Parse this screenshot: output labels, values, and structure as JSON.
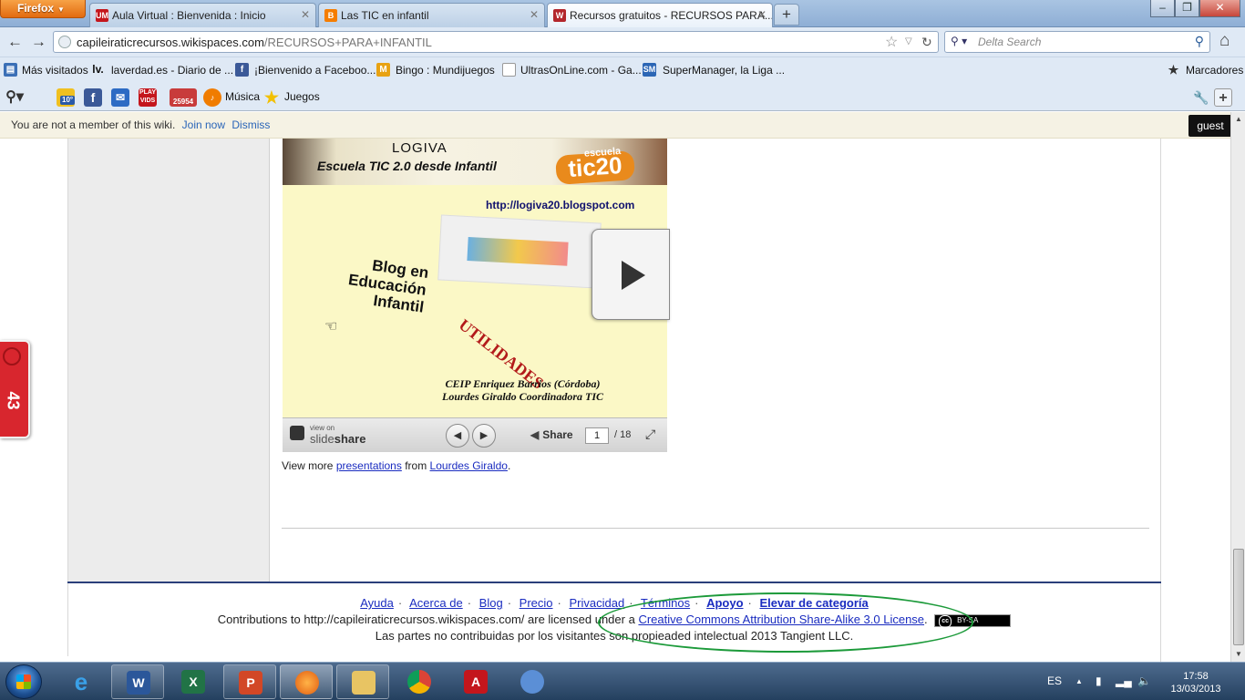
{
  "browser": {
    "menu_label": "Firefox",
    "tabs": [
      {
        "title": "Aula Virtual : Bienvenida : Inicio",
        "favicon": "UM"
      },
      {
        "title": "Las TIC en infantil",
        "favicon": "B"
      },
      {
        "title": "Recursos gratuitos - RECURSOS PARA...",
        "favicon": "W"
      }
    ],
    "new_tab": "+",
    "window_buttons": {
      "minimize": "–",
      "maximize": "❐",
      "close": "✕"
    }
  },
  "navbar": {
    "back": "←",
    "forward": "→",
    "url_host": "capileiraticrecursos.wikispaces.com",
    "url_path": "/RECURSOS+PARA+INFANTIL",
    "search_placeholder": "Delta Search",
    "home": "⌂"
  },
  "bookmarks": [
    {
      "label": "Más visitados",
      "icon": "bookmarks-folder-icon"
    },
    {
      "label": "laverdad.es - Diario de ...",
      "icon": "laverdad-icon"
    },
    {
      "label": "¡Bienvenido a Faceboo...",
      "icon": "facebook-icon"
    },
    {
      "label": "Bingo : Mundijuegos",
      "icon": "mundijuegos-icon"
    },
    {
      "label": "UltrasOnLine.com - Ga...",
      "icon": "blank-page-icon"
    },
    {
      "label": "SuperManager, la Liga ...",
      "icon": "supermanager-icon"
    }
  ],
  "bookmarks_menu": "Marcadores",
  "toolbar": {
    "weather": "10°",
    "mail_count": "25954",
    "music": "Música",
    "games": "Juegos"
  },
  "notice": {
    "text": "You are not a member of this wiki.",
    "join": "Join now",
    "dismiss": "Dismiss",
    "guest": "guest"
  },
  "slide": {
    "header_title": "LOGIVA",
    "header_sub": "Escuela  TIC 2.0    desde Infantil",
    "badge": "tic20",
    "badge_small": "escuela",
    "url": "http://logiva20.blogspot.com",
    "blog_line1": "Blog en",
    "blog_line2": "Educación",
    "blog_line3": "Infantil",
    "utilidades": "UTILIDADES",
    "ceip_line1": "CEIP Enriquez Barrios (Córdoba)",
    "ceip_line2": "Lourdes Giraldo Coordinadora TIC"
  },
  "slideshare": {
    "view_on": "view on",
    "brand_light": "slide",
    "brand_bold": "share",
    "share": "Share",
    "page": "1",
    "total": "/ 18"
  },
  "viewmore": {
    "prefix": "View more",
    "link1": "presentations",
    "middle": "from",
    "link2": "Lourdes Giraldo",
    "suffix": "."
  },
  "footer": {
    "links": [
      "Ayuda",
      "Acerca de",
      "Blog",
      "Precio",
      "Privacidad",
      "Términos",
      "Apoyo",
      "Elevar de categoría"
    ],
    "license_prefix": "Contributions to http://capileiraticrecursos.wikispaces.com/ are licensed under a",
    "license_link": "Creative Commons Attribution Share-Alike 3.0 License",
    "license_suffix": ".",
    "cc_badge": "BY-SA",
    "rights": "Las partes no contribuidas por los visitantes son propieaded intelectual 2013 Tangient LLC."
  },
  "side_badge": "43",
  "taskbar": {
    "apps": [
      "internet-explorer",
      "word",
      "excel",
      "powerpoint",
      "firefox",
      "explorer",
      "chrome",
      "acrobat",
      "paint"
    ],
    "lang": "ES",
    "time": "17:58",
    "date": "13/03/2013"
  },
  "colors": {
    "accent_link": "#1a2cc0",
    "highlight_ellipse": "#1c9a3a",
    "side_badge": "#d8262e"
  }
}
